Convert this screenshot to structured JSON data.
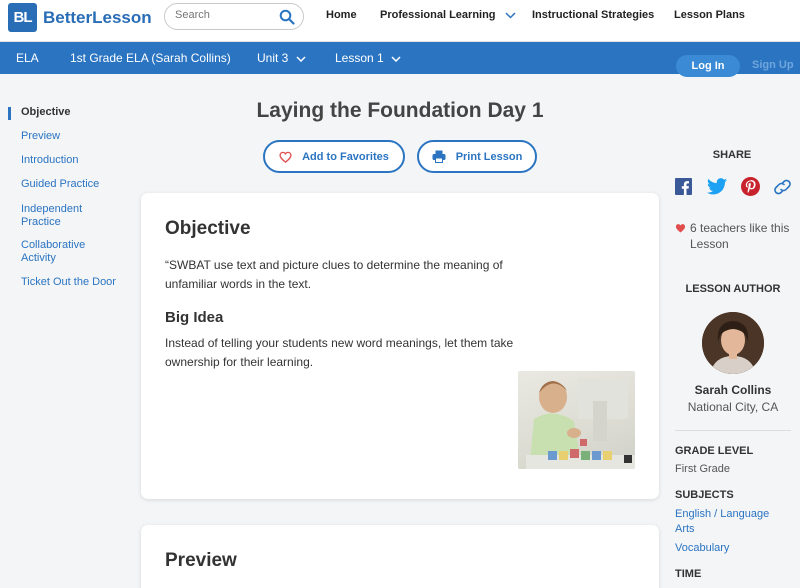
{
  "header": {
    "logo_mark": "BL",
    "logo_text": "BetterLesson",
    "search_placeholder": "Search",
    "nav": [
      "Home",
      "Professional Learning",
      "Instructional Strategies",
      "Lesson Plans"
    ]
  },
  "coursebar": {
    "subject": "ELA",
    "course": "1st Grade ELA (Sarah Collins)",
    "unit": "Unit 3",
    "lesson": "Lesson 1",
    "login": "Log In",
    "signup": "Sign Up"
  },
  "sections": [
    "Objective",
    "Preview",
    "Introduction",
    "Guided Practice",
    "Independent Practice",
    "Collaborative Activity",
    "Ticket Out the Door"
  ],
  "lesson": {
    "title": "Laying the Foundation Day 1",
    "add_favorites": "Add to Favorites",
    "print": "Print Lesson"
  },
  "objective_card": {
    "heading": "Objective",
    "text": "“SWBAT use text and picture clues to determine the meaning of unfamiliar words in the text.",
    "big_idea_heading": "Big Idea",
    "big_idea_text": "Instead of telling your students new word meanings, let them take ownership for their learning."
  },
  "preview_card": {
    "heading": "Preview"
  },
  "sidebar": {
    "share_label": "SHARE",
    "likes": "6 teachers like this Lesson",
    "author_label": "LESSON AUTHOR",
    "author_name": "Sarah Collins",
    "author_location": "National City, CA",
    "grade_label": "GRADE LEVEL",
    "grade_value": "First Grade",
    "subjects_label": "SUBJECTS",
    "subjects": [
      "English / Language Arts",
      "Vocabulary"
    ],
    "time_label": "TIME"
  },
  "colors": {
    "brand_blue": "#2a74c2",
    "heart_red": "#e04e4e",
    "facebook": "#3b5998",
    "twitter": "#1da1f2",
    "pinterest": "#c8232c"
  }
}
